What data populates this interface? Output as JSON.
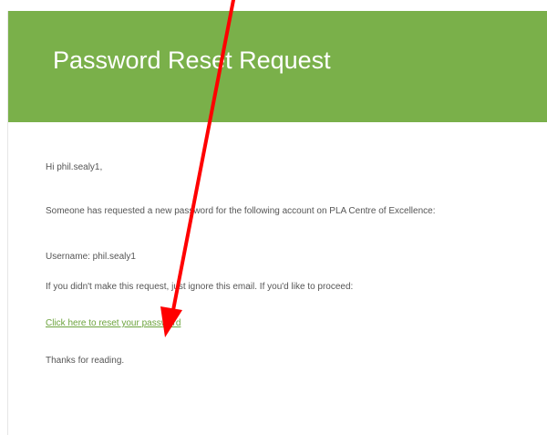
{
  "email": {
    "title": "Password Reset Request",
    "greeting": "Hi phil.sealy1,",
    "request_text": "Someone has requested a new password for the following account on PLA Centre of Excellence:",
    "username_line": "Username: phil.sealy1",
    "ignore_text": "If you didn't make this request, just ignore this email. If you'd like to proceed:",
    "reset_link_label": "Click here to reset your password",
    "thanks_text": "Thanks for reading."
  },
  "colors": {
    "header_green": "#7ab04a",
    "link_green": "#6da33e",
    "annotation_red": "#ff0000"
  },
  "annotation": {
    "icon": "red-arrow-icon"
  }
}
